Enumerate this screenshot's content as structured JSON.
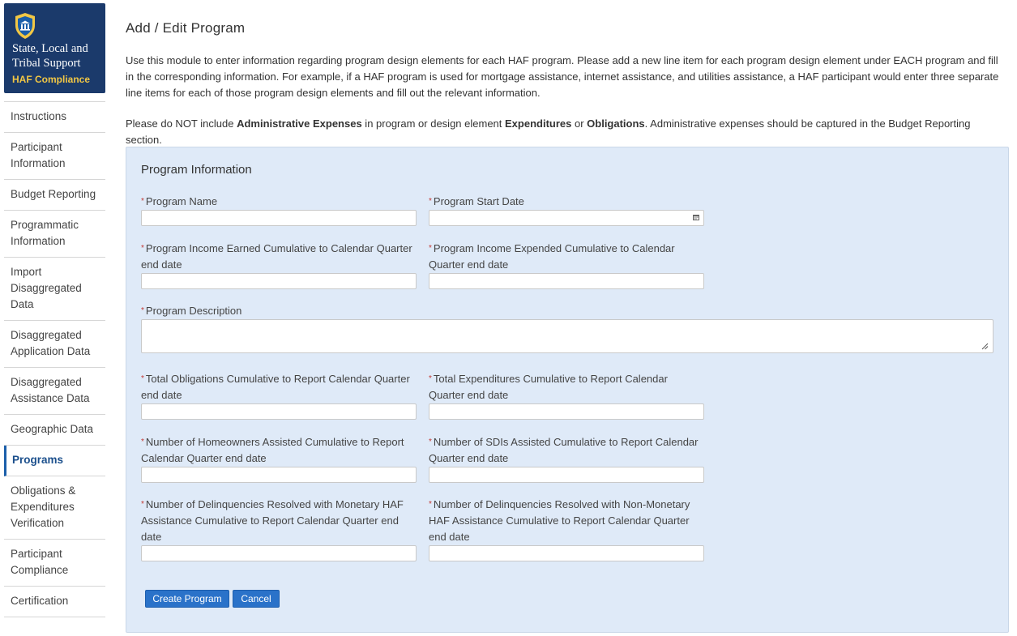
{
  "brand": {
    "title": "State, Local and Tribal Support",
    "subtitle": "HAF Compliance",
    "icon": "building-shield-icon"
  },
  "nav": {
    "items": [
      {
        "label": "Instructions",
        "active": false
      },
      {
        "label": "Participant Information",
        "active": false
      },
      {
        "label": "Budget Reporting",
        "active": false
      },
      {
        "label": "Programmatic Information",
        "active": false
      },
      {
        "label": "Import Disaggregated Data",
        "active": false
      },
      {
        "label": "Disaggregated Application Data",
        "active": false
      },
      {
        "label": "Disaggregated Assistance Data",
        "active": false
      },
      {
        "label": "Geographic Data",
        "active": false
      },
      {
        "label": "Programs",
        "active": true
      },
      {
        "label": "Obligations & Expenditures Verification",
        "active": false
      },
      {
        "label": "Participant Compliance",
        "active": false
      },
      {
        "label": "Certification",
        "active": false
      }
    ]
  },
  "page": {
    "title": "Add / Edit Program",
    "intro": "Use this module to enter information regarding program design elements for each HAF program. Please add a new line item for each program design element under EACH program and fill in the corresponding information. For example, if a HAF program is used for mortgage assistance, internet assistance, and utilities assistance, a HAF participant would enter three separate line items for each of those program design elements and fill out the relevant information.",
    "notice": {
      "p1": "Please do NOT include ",
      "b1": "Administrative Expenses",
      "p2": " in program or design element ",
      "b2": "Expenditures",
      "p3": " or ",
      "b3": "Obligations",
      "p4": ". Administrative expenses should be captured in the Budget Reporting section."
    }
  },
  "form": {
    "section_title": "Program Information",
    "required_marker": "*",
    "fields": {
      "program_name": {
        "label": "Program Name",
        "value": ""
      },
      "program_start_date": {
        "label": "Program Start Date",
        "value": ""
      },
      "income_earned": {
        "label": "Program Income Earned Cumulative to Calendar Quarter end date",
        "value": ""
      },
      "income_expended": {
        "label": "Program Income Expended Cumulative to Calendar Quarter end date",
        "value": ""
      },
      "description": {
        "label": "Program Description",
        "value": ""
      },
      "total_obligations": {
        "label": "Total Obligations Cumulative to Report Calendar Quarter end date",
        "value": ""
      },
      "total_expenditures": {
        "label": "Total Expenditures Cumulative to Report Calendar Quarter end date",
        "value": ""
      },
      "homeowners_assisted": {
        "label": "Number of Homeowners Assisted Cumulative to Report Calendar Quarter end date",
        "value": ""
      },
      "sdis_assisted": {
        "label": "Number of SDIs Assisted Cumulative to Report Calendar Quarter end date",
        "value": ""
      },
      "delinquencies_monetary": {
        "label": "Number of Delinquencies Resolved with Monetary HAF Assistance Cumulative to Report Calendar Quarter end date",
        "value": ""
      },
      "delinquencies_non_monetary": {
        "label": "Number of Delinquencies Resolved with Non-Monetary HAF Assistance Cumulative to Report Calendar Quarter end date",
        "value": ""
      }
    },
    "buttons": {
      "create": "Create Program",
      "cancel": "Cancel"
    }
  },
  "colors": {
    "brand_bg": "#1b3a6b",
    "brand_accent": "#f2c744",
    "panel_bg": "#dfeaf8",
    "button_bg": "#2a72c9",
    "required": "#c23934"
  }
}
